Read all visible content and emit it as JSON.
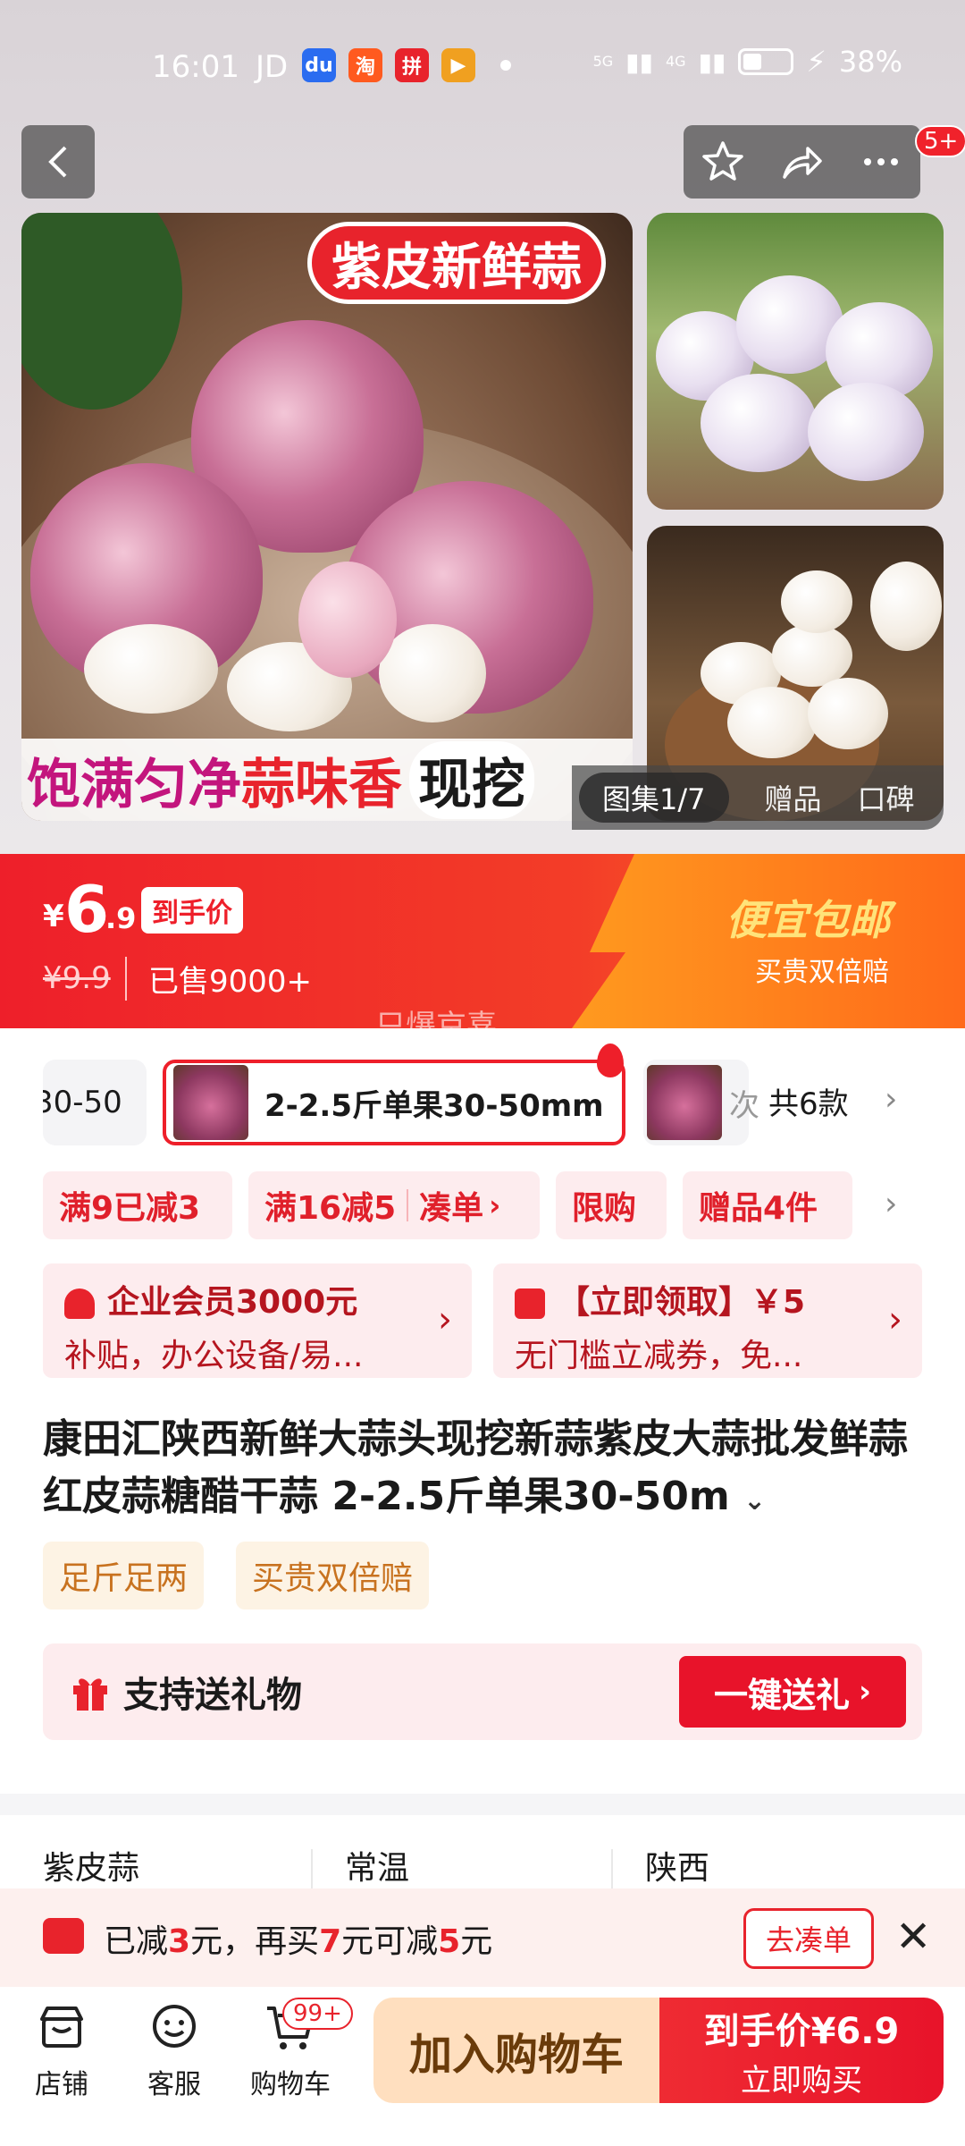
{
  "status": {
    "time": "16:01",
    "carrier": "JD",
    "signal": "5G",
    "signal2": "4G",
    "battery": "38%"
  },
  "gallery": {
    "promo_top": "紫皮新鲜蒜",
    "promo_bottom_a": "饱满匀净",
    "promo_bottom_b": "蒜味香",
    "promo_bottom_c": "现挖",
    "tab_active": "图集1/7",
    "tab_gift": "赠品",
    "tab_review": "口碑",
    "nav_badge": "5+"
  },
  "price": {
    "yen": "¥",
    "big": "6",
    "small": ".9",
    "tag": "到手价",
    "old": "¥9.9",
    "sold": "已售9000+",
    "free_ship": "便宜包邮",
    "double_pay": "买贵双倍赔",
    "brand_watermark": "只爆京喜"
  },
  "variants": {
    "prev_label": "30-50",
    "selected_label": "2-2.5斤单果30-50mm",
    "next_label": "次",
    "count": "共6款"
  },
  "chips": {
    "c1": "满9已减3",
    "c2a": "满16减5",
    "c2b": "凑单",
    "c3": "限购",
    "c4": "赠品4件"
  },
  "benefits": {
    "b1_line1": "企业会员3000元",
    "b1_line2": "补贴，办公设备/易...",
    "b2_line1": "【立即领取】￥5",
    "b2_line2": "无门槛立减券，免..."
  },
  "product": {
    "title": "康田汇陕西新鲜大蒜头现挖新蒜紫皮大蒜批发鲜蒜红皮蒜糖醋干蒜 2-2.5斤单果30-50m",
    "tag1": "足斤足两",
    "tag2": "买贵双倍赔",
    "gift_text": "支持送礼物",
    "gift_btn": "一键送礼"
  },
  "specs": {
    "s1": "紫皮蒜",
    "s2": "常温",
    "s3": "陕西"
  },
  "promo_bar": {
    "text_a": "已减",
    "v1": "3",
    "text_b": "元，再买",
    "v2": "7",
    "text_c": "元可减",
    "v3": "5",
    "text_d": "元",
    "btn": "去凑单"
  },
  "bottom": {
    "store": "店铺",
    "service": "客服",
    "cart": "购物车",
    "cart_badge": "99+",
    "add_cart": "加入购物车",
    "buy_top": "到手价¥6.9",
    "buy_bottom": "立即购买"
  },
  "colors": {
    "accent": "#e8232c",
    "orange": "#ff7a22"
  }
}
